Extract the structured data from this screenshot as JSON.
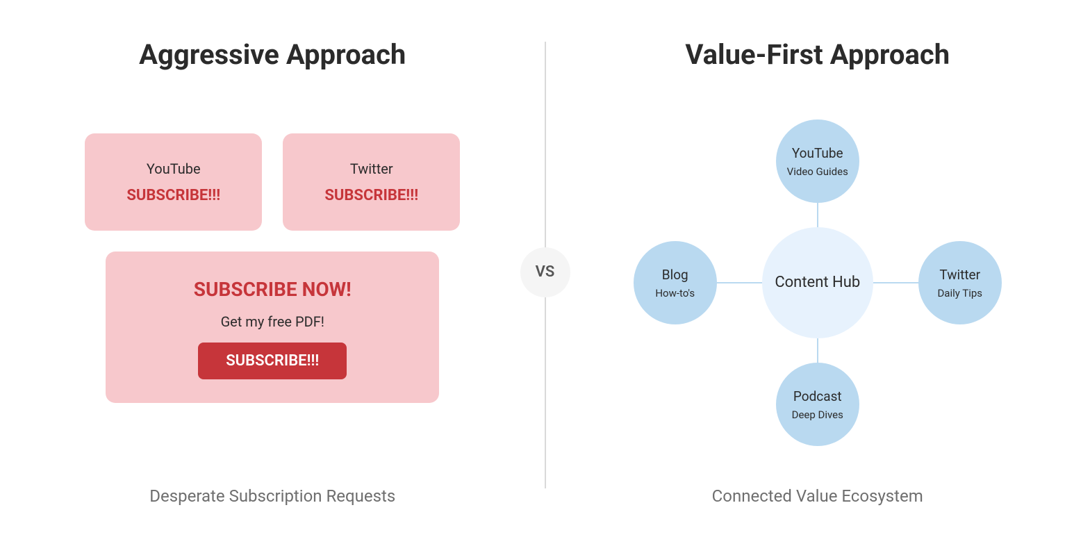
{
  "left": {
    "title": "Aggressive Approach",
    "cards": {
      "youtube": {
        "name": "YouTube",
        "cta": "SUBSCRIBE!!!"
      },
      "twitter": {
        "name": "Twitter",
        "cta": "SUBSCRIBE!!!"
      }
    },
    "popup": {
      "headline": "SUBSCRIBE NOW!",
      "sub": "Get my free PDF!",
      "button": "SUBSCRIBE!!!"
    },
    "footer": "Desperate Subscription Requests"
  },
  "vs": "VS",
  "right": {
    "title": "Value-First Approach",
    "hub": {
      "center": "Content Hub",
      "nodes": {
        "top": {
          "title": "YouTube",
          "sub": "Video Guides"
        },
        "right": {
          "title": "Twitter",
          "sub": "Daily Tips"
        },
        "bottom": {
          "title": "Podcast",
          "sub": "Deep Dives"
        },
        "left": {
          "title": "Blog",
          "sub": "How-to's"
        }
      }
    },
    "footer": "Connected Value Ecosystem"
  },
  "colors": {
    "red_bg": "#f7c8cc",
    "red_text": "#c6353a",
    "blue_light": "#e7f2fd",
    "blue_node": "#b9d9f0",
    "line": "#b9d9f0"
  }
}
